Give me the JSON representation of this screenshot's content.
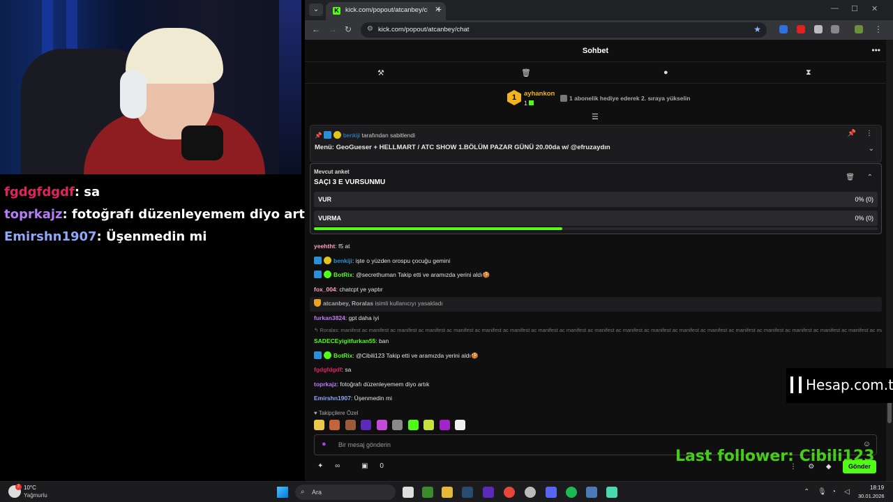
{
  "stream_overlay": {
    "chat": [
      {
        "user": "fgdgfdgdf",
        "text": ": sa",
        "color": "#e0245e"
      },
      {
        "user": "toprkajz",
        "text": ": fotoğrafı düzenleyemem diyo artık",
        "color": "#b77cf7"
      },
      {
        "user": "Emirshn1907",
        "text": ": Üşenmedin mi",
        "color": "#8fa8f8"
      }
    ],
    "brand": "Hesap.com.tr",
    "last_follower": "Last follower: Cibili123"
  },
  "browser": {
    "tab_title": "kick.com/popout/atcanbey/cha",
    "url": "kick.com/popout/atcanbey/chat"
  },
  "chat": {
    "title": "Sohbet",
    "gift": {
      "rank": "1",
      "user": "ayhankon",
      "count": "1",
      "prompt": "1 abonelik hediye ederek 2. sıraya yükselin"
    },
    "pinned": {
      "by_user": "benkiji",
      "by_suffix": "tarafından sabitlendi",
      "text": "Menü: GeoGueser + HELLMART / ATC SHOW 1.BÖLÜM PAZAR GÜNÜ 20.00da w/ @efruzaydın"
    },
    "poll": {
      "label": "Mevcut anket",
      "question": "SAÇI 3 E VURSUNMU",
      "options": [
        {
          "label": "VUR",
          "result": "0% (0)"
        },
        {
          "label": "VURMA",
          "result": "0% (0)"
        }
      ],
      "time_remaining_fraction": 0.44
    },
    "messages": [
      {
        "user": "yeehtht",
        "text": ": f5 at",
        "color": "#ff9ec4"
      },
      {
        "user": "benkiji",
        "text": ": işte o yüzden orospu çocuğu gemini",
        "color": "#2a8fd8"
      },
      {
        "user": "BotRix",
        "text": ": @secrethuman Takip etti ve aramızda yerini aldı🍪",
        "color": "#53fc18"
      },
      {
        "user": "fox_004",
        "text": ": chatcpt ye yaptır",
        "color": "#ff9ec4"
      },
      {
        "user": "atcanbey, Roralas",
        "text": " isimli kullanıcıyı yasakladı",
        "color": "#aaaaaa"
      },
      {
        "user": "furkan3824",
        "text": ": gpt daha iyi",
        "color": "#c27cf7"
      },
      {
        "reply": "↰ Roralas: manifest ac manifest ac manifest ac manifest ac manifest ac manifest ac manifest ac manifest ac manifest ac manifest ac manifest ac manifest ac manifest ac manifest ac manifest ac manifest ac manifest ac manifest ac manifest ac manif..."
      },
      {
        "user": "SADECEyigitfurkan55",
        "text": ": ban",
        "color": "#53fc18"
      },
      {
        "user": "BotRix",
        "text": ": @Cibili123 Takip etti ve aramızda yerini aldı🍪",
        "color": "#53fc18"
      },
      {
        "user": "fgdgfdgdf",
        "text": ": sa",
        "color": "#e0245e"
      },
      {
        "user": "toprkajz",
        "text": ": fotoğrafı düzenleyemem diyo artık",
        "color": "#b77cf7"
      },
      {
        "user": "Emirshn1907",
        "text": ": Üşenmedin mi",
        "color": "#8fa8f8"
      }
    ],
    "followers_only": "♥ Takipçilere Özel",
    "input_placeholder": "Bir mesaj gönderin",
    "points": "∞",
    "gift_count": "0",
    "send_label": "Gönder"
  },
  "taskbar": {
    "weather_temp": "10°C",
    "weather_desc": "Yağmurlu",
    "weather_alert": "2",
    "search_placeholder": "Ara",
    "time": "18:19",
    "date": "30.01.2026"
  },
  "colors": {
    "accent": "#53fc18",
    "gift_gold": "#f2b31b",
    "bg": "#0f0f10"
  }
}
